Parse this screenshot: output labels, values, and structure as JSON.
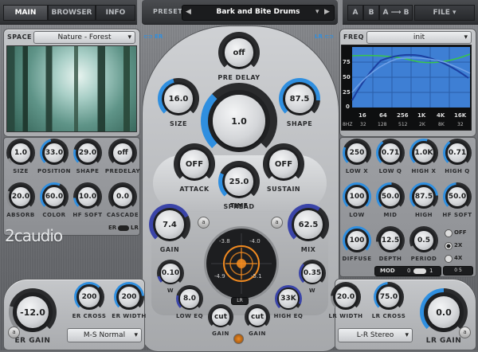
{
  "tabs": {
    "main": "MAIN",
    "browser": "BROWSER",
    "info": "INFO"
  },
  "preset": {
    "label": "PRESET",
    "name": "Bark and Bite Drums",
    "prev": "◀",
    "next": "▶",
    "dropdown": "▾"
  },
  "ab": {
    "a": "A",
    "b": "B",
    "a_to_b": "A ⟶ B",
    "file": "FILE"
  },
  "space": {
    "label": "SPACE",
    "value": "Nature - Forest"
  },
  "links": {
    "er": "ER",
    "lr": "LR"
  },
  "freq": {
    "label": "FREQ",
    "value": "init",
    "y_ticks": [
      "75",
      "50",
      "25",
      "0"
    ],
    "x_ticks": [
      "16",
      "64",
      "256",
      "1K",
      "4K",
      "16K"
    ],
    "x_ticks2": [
      "8HZ",
      "32",
      "128",
      "512",
      "2K",
      "8K",
      "32"
    ]
  },
  "left_knobs": [
    {
      "value": "1.0",
      "label": "SIZE"
    },
    {
      "value": "33.0",
      "label": "POSITION"
    },
    {
      "value": "29.0",
      "label": "SHAPE"
    },
    {
      "value": "off",
      "label": "PREDELAY"
    },
    {
      "value": "20.0",
      "label": "ABSORB"
    },
    {
      "value": "60.0",
      "label": "COLOR"
    },
    {
      "value": "10.0",
      "label": "HF SOFT"
    },
    {
      "value": "0.0",
      "label": "CASCADE"
    }
  ],
  "er_lr_toggle": {
    "er": "ER",
    "lr": "LR"
  },
  "brand": "2caudio",
  "center": {
    "pre_delay": {
      "value": "off",
      "label": "PRE DELAY"
    },
    "size": {
      "value": "16.0",
      "label": "SIZE"
    },
    "time": {
      "value": "1.0",
      "label": "TIME"
    },
    "shape": {
      "value": "87.5",
      "label": "SHAPE"
    },
    "attack": {
      "value": "OFF",
      "label": "ATTACK"
    },
    "sustain": {
      "value": "OFF",
      "label": "SUSTAIN"
    },
    "spread": {
      "value": "25.0",
      "label": "SPREAD"
    },
    "gain": {
      "value": "7.4",
      "label": "GAIN"
    },
    "mix": {
      "value": "62.5",
      "label": "MIX"
    },
    "w1": {
      "value": "0.10",
      "label": "W"
    },
    "w2": {
      "value": "0.35",
      "label": "W"
    },
    "low_eq": {
      "value": "8.0",
      "label": "LOW EQ"
    },
    "high_eq": {
      "value": "33K",
      "label": "HIGH EQ"
    },
    "cut1": {
      "value": "cut",
      "label": "GAIN"
    },
    "cut2": {
      "value": "cut",
      "label": "GAIN"
    },
    "scope": {
      "tl": "-3.8",
      "tr": "-4.0",
      "bl": "-4.9",
      "br": "-5.1",
      "mode": "LR"
    }
  },
  "right_knobs": [
    {
      "value": "250",
      "label": "LOW X"
    },
    {
      "value": "0.71",
      "label": "LOW Q"
    },
    {
      "value": "1.0K",
      "label": "HIGH X"
    },
    {
      "value": "0.71",
      "label": "HIGH Q"
    },
    {
      "value": "100",
      "label": "LOW"
    },
    {
      "value": "50.0",
      "label": "MID"
    },
    {
      "value": "87.5",
      "label": "HIGH"
    },
    {
      "value": "50.0",
      "label": "HF SOFT"
    },
    {
      "value": "100",
      "label": "DIFFUSE"
    },
    {
      "value": "12.5",
      "label": "DEPTH"
    },
    {
      "value": "0.5",
      "label": "PERIOD"
    }
  ],
  "oversample": {
    "options": [
      "OFF",
      "2X",
      "4X"
    ],
    "selected": "2X",
    "footer": "0 5"
  },
  "mod": {
    "label": "MOD",
    "left": "0",
    "right": "1"
  },
  "bottom": {
    "er_gain": {
      "value": "-12.0",
      "label": "ER GAIN"
    },
    "er_cross": {
      "value": "200",
      "label": "ER CROSS"
    },
    "er_width": {
      "value": "200",
      "label": "ER WIDTH"
    },
    "er_mode": "M-S Normal",
    "lr_width": {
      "value": "20.0",
      "label": "LR WIDTH"
    },
    "lr_cross": {
      "value": "75.0",
      "label": "LR CROSS"
    },
    "lr_mode": "L-R Stereo",
    "lr_gain": {
      "value": "0.0",
      "label": "LR GAIN"
    },
    "lock": "a"
  },
  "colors": {
    "accent": "#2f8fe0",
    "orange": "#f08a20",
    "dark": "#1b1c1e"
  }
}
